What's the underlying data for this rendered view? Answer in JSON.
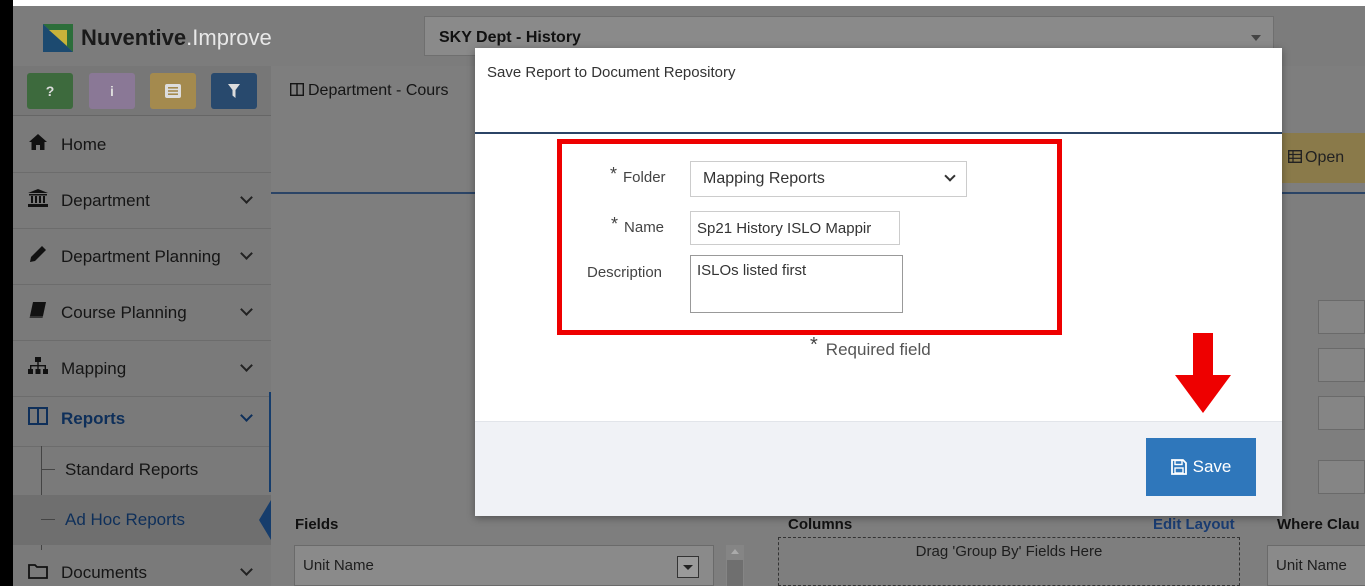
{
  "app": {
    "logo_bold": "Nuventive",
    "logo_light": ".Improve",
    "unit_selector": "SKY Dept - History"
  },
  "toolbox": {
    "help": "?",
    "info": "i"
  },
  "sidebar": {
    "items": [
      {
        "label": "Home",
        "icon": "home-icon"
      },
      {
        "label": "Department",
        "icon": "bank-icon"
      },
      {
        "label": "Department Planning",
        "icon": "pencil-icon"
      },
      {
        "label": "Course Planning",
        "icon": "book-icon"
      },
      {
        "label": "Mapping",
        "icon": "sitemap-icon"
      },
      {
        "label": "Reports",
        "icon": "columns-icon"
      },
      {
        "label": "Documents",
        "icon": "folder-icon"
      }
    ],
    "sub_items": [
      {
        "label": "Standard Reports"
      },
      {
        "label": "Ad Hoc Reports"
      }
    ]
  },
  "main": {
    "breadcrumb": "Department - Cours",
    "open_button": "Open",
    "fields_label": "Fields",
    "fields_first": "Unit Name",
    "columns_label": "Columns",
    "edit_layout": "Edit Layout",
    "drop_zone": "Drag 'Group By' Fields Here",
    "where_label": "Where Clau",
    "where_first": "Unit Name"
  },
  "modal": {
    "title": "Save Report to Document Repository",
    "folder_label": "Folder",
    "folder_value": "Mapping Reports",
    "name_label": "Name",
    "name_value": "Sp21 History ISLO Mappir",
    "description_label": "Description",
    "description_value": "ISLOs listed first",
    "required_note": "Required field",
    "required_mark": "*",
    "save_label": "Save"
  },
  "colors": {
    "accent": "#2f77bb",
    "annotation": "#ee0000",
    "nav_active": "#0e2f5a"
  }
}
